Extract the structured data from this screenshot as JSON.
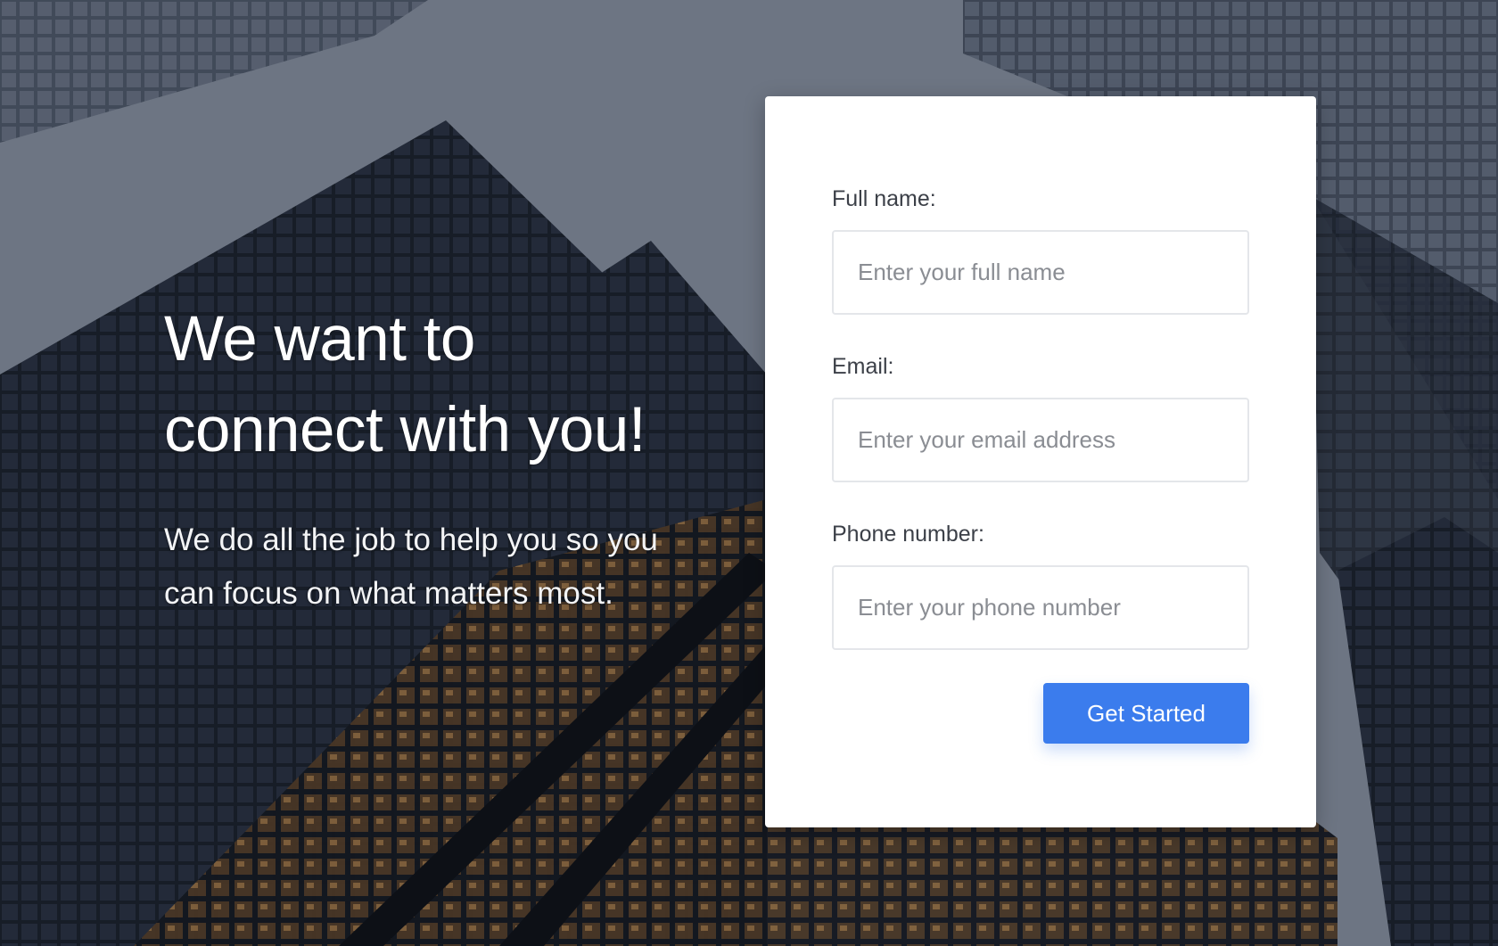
{
  "hero": {
    "title_line1": "We want to",
    "title_line2": "connect with you!",
    "subtitle_line1": "We do all the job to help you so you",
    "subtitle_line2": "can focus on what matters most."
  },
  "form": {
    "fields": [
      {
        "label": "Full name:",
        "placeholder": "Enter your full name",
        "value": ""
      },
      {
        "label": "Email:",
        "placeholder": "Enter your email address",
        "value": ""
      },
      {
        "label": "Phone number:",
        "placeholder": "Enter your phone number",
        "value": ""
      }
    ],
    "submit_label": "Get Started"
  },
  "colors": {
    "accent": "#3b7ced",
    "card_background": "#ffffff",
    "label_text": "#3c4048",
    "placeholder_text": "#8a8d93"
  }
}
